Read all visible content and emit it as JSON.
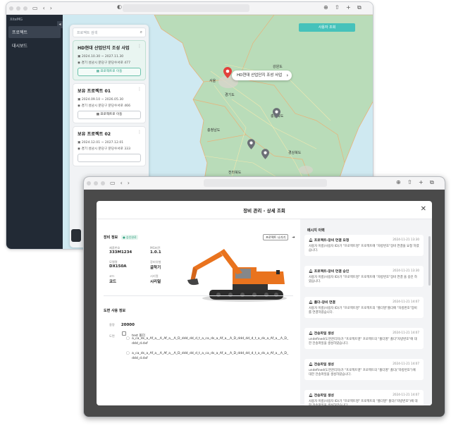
{
  "back_window": {
    "brand": "XiteMG",
    "nav": [
      "프로젝트",
      "대시보드"
    ],
    "search_placeholder": "프로젝트 검색",
    "lookup_button": "사용자 조회",
    "projects": [
      {
        "title": "HD현대 산업단지 조성 사업",
        "dates": "2024.10.30 ~ 2027.11.30",
        "address": "경기 성남시 분당구 분당수서로 477",
        "button": "프로젝트로 이동"
      },
      {
        "title": "보유 프로젝트 01",
        "dates": "2024.09.10 ~ 2026.05.30",
        "address": "경기 성남시 분당구 분당수서로 466",
        "button": "프로젝트로 이동"
      },
      {
        "title": "보유 프로젝트 02",
        "dates": "2024.12.01 ~ 2027.12.01",
        "address": "경기 성남시 분당구 분당수서로 333",
        "button": ""
      }
    ],
    "map": {
      "callout": "HD현대 산업단지 조성 사업",
      "labels": [
        "강원도",
        "서울",
        "충청북도",
        "충청남도",
        "경상북도",
        "전라북도",
        "경기도"
      ]
    }
  },
  "modal": {
    "title": "장비 관리 - 상세 조회",
    "equipment_info": {
      "heading": "장비 정보",
      "status": "승인완료",
      "export_button": "프로젝트 나가기",
      "fields": [
        {
          "label": "제품번호",
          "value": "333M1234"
        },
        {
          "label": "MG버전",
          "value": "1.0.1"
        },
        {
          "label": "모델명",
          "value": "DX150A"
        },
        {
          "label": "장비유형",
          "value": "굴착기"
        },
        {
          "label": "코드",
          "value": "코드"
        },
        {
          "label": "시리얼",
          "value": "시리얼"
        }
      ]
    },
    "drawing_info": {
      "heading": "도면 사용 정보",
      "capacity_label": "용량",
      "capacity_value": "20000",
      "drawing_label": "도면",
      "folder": "test 폴더",
      "files": [
        "a_ca_ds_a_Af_a__A_Af_a__A_D_ddd_dd_d_t_a_ca_ds_a_Af_a__A_D_ddd_dd_d_t_a_ds_a_Af_a__A_D_ddd_d.dxf",
        "a_ca_ds_a_Af_a__A_Af_a__A_D_ddd_dd_d_t_a_ca_ds_a_Af_a__A_D_ddd_dd_d_t_a_ds_a_Af_a__A_D_ddd_d.dxf"
      ]
    },
    "history": {
      "heading": "메시지 이력",
      "items": [
        {
          "title": "프로젝트-장비 연결 요청",
          "date": "2024-11-21 13:30",
          "body": "사용자 이름(사용자 ID)가 \"프로젝트명\" 프로젝트에 \"자방번호\"장비 연결을 요청 하였습니다."
        },
        {
          "title": "프로젝트-장비 연결 승인",
          "date": "2024-11-21 13:30",
          "body": "사용자 이름(사용자 ID)가 \"프로젝트명\" 프로젝트에 \"자방번호\"장비 연결 을 승인 하였습니다."
        },
        {
          "title": "폴더-장비 연결",
          "date": "2024-11-21 14:07",
          "body": "사용자 이름(사용자 ID)가 \"프로젝트명\" 프로젝트의 \"폴더명\"폴더에 \"자방번호\"장비를 연결하였습니다."
        },
        {
          "title": "전송파일 생성",
          "date": "2024-11-21 14:07",
          "body": "undefined(도면관리자)가 \"프로젝트명\" 프로젝트의 \"폴더명\" 폴더\"자방번호\"에 대한 전송파일을 생성하였습니다."
        },
        {
          "title": "전송파일 생성",
          "date": "2024-11-21 14:07",
          "body": "undefined(도면관리자)가 \"프로젝트명\" 프로젝트의 \"폴더명\" 폴더(\"자방번호\")에 대한 전송파일을 생성하였습니다."
        },
        {
          "title": "전송파일 생성",
          "date": "2024-11-21 14:07",
          "body": "사용자 이름(사용자 ID)가 \"프로젝트명\" 프로젝트의 \"폴더명\" 폴더(\"자방번호\")에 대한 전송파일을 생성하였습니다."
        }
      ]
    }
  },
  "colors": {
    "accent": "#46c2bb",
    "sidebar": "#222a35",
    "pin_active": "#e2413c",
    "pin": "#6b6f76"
  }
}
